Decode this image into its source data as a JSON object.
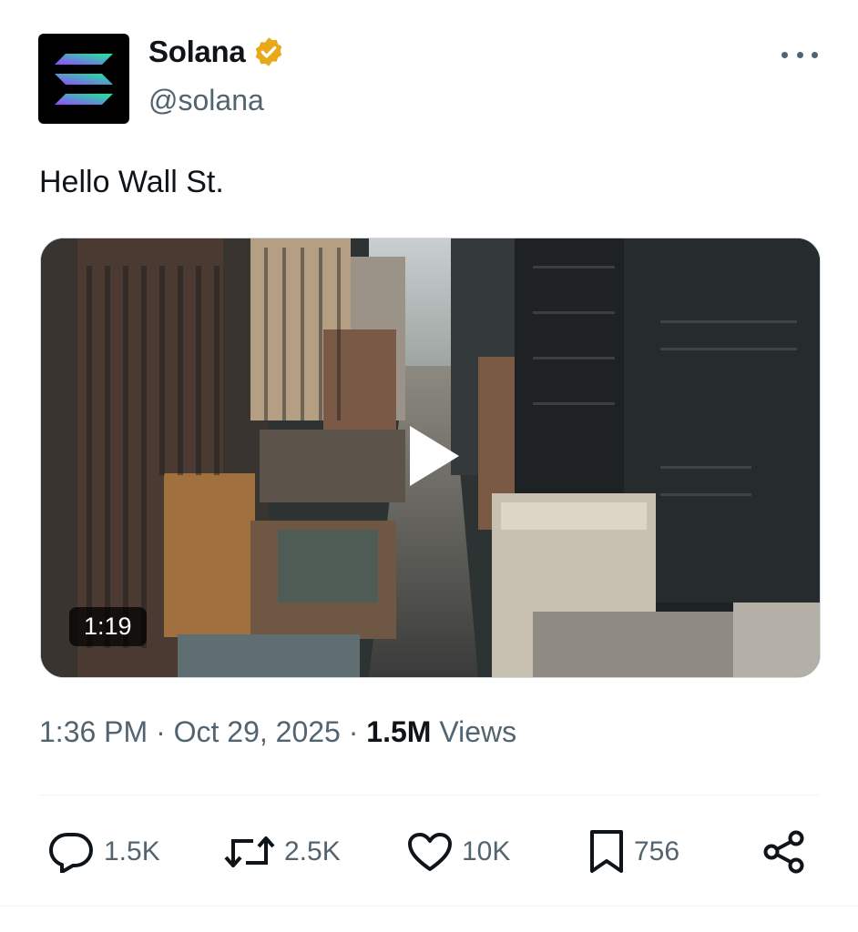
{
  "author": {
    "display_name": "Solana",
    "handle": "@solana",
    "verified_icon": "verified-badge-icon",
    "avatar_icon": "solana-logo-icon"
  },
  "tweet": {
    "text": "Hello Wall St."
  },
  "media": {
    "type": "video",
    "duration": "1:19",
    "play_icon": "play-icon"
  },
  "meta": {
    "time": "1:36 PM",
    "separator": " · ",
    "date": "Oct 29, 2025",
    "views_count": "1.5M",
    "views_label": " Views"
  },
  "actions": {
    "reply": {
      "icon": "reply-icon",
      "count": "1.5K"
    },
    "repost": {
      "icon": "repost-icon",
      "count": "2.5K"
    },
    "like": {
      "icon": "heart-icon",
      "count": "10K"
    },
    "bookmark": {
      "icon": "bookmark-icon",
      "count": "756"
    },
    "share": {
      "icon": "share-icon"
    }
  },
  "colors": {
    "text_primary": "#0f1419",
    "text_secondary": "#536471",
    "verified_gold": "#e8a919",
    "solana_gradient_start": "#9945ff",
    "solana_gradient_end": "#14f195"
  }
}
